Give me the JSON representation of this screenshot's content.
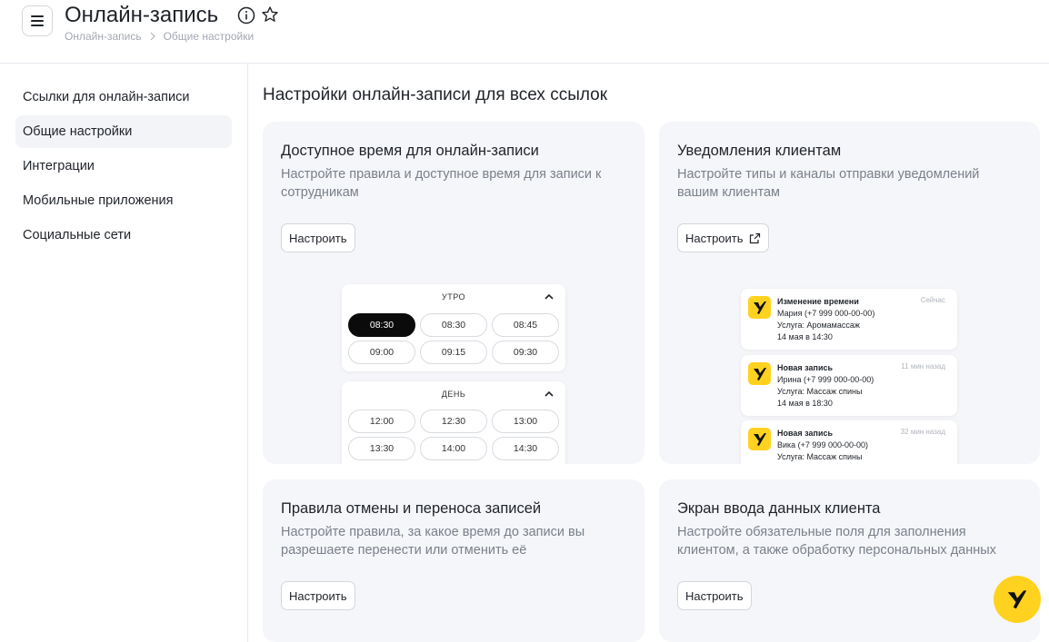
{
  "header": {
    "title": "Онлайн-запись",
    "breadcrumb": [
      "Онлайн-запись",
      "Общие настройки"
    ]
  },
  "sidebar": {
    "items": [
      {
        "label": "Ссылки для онлайн-записи"
      },
      {
        "label": "Общие настройки"
      },
      {
        "label": "Интеграции"
      },
      {
        "label": "Мобильные приложения"
      },
      {
        "label": "Социальные сети"
      }
    ]
  },
  "main": {
    "title": "Настройки онлайн-записи для всех ссылок",
    "cards": [
      {
        "title": "Доступное время для онлайн-записи",
        "desc": "Настройте правила и доступное время для записи к сотрудникам",
        "button": "Настроить"
      },
      {
        "title": "Уведомления клиентам",
        "desc": "Настройте типы и каналы отправки уведомлений вашим клиентам",
        "button": "Настроить"
      },
      {
        "title": "Правила отмены и переноса записей",
        "desc": "Настройте правила, за какое время до записи вы разрешаете перенести или отменить её",
        "button": "Настроить"
      },
      {
        "title": "Экран ввода данных клиента",
        "desc": "Настройте обязательные поля для заполнения клиентом, а также обработку персональных данных",
        "button": "Настроить"
      }
    ],
    "slots": {
      "morning": {
        "label": "УТРО",
        "times": [
          "08:30",
          "08:30",
          "08:45",
          "09:00",
          "09:15",
          "09:30"
        ]
      },
      "day": {
        "label": "ДЕНЬ",
        "times": [
          "12:00",
          "12:30",
          "13:00",
          "13:30",
          "14:00",
          "14:30"
        ]
      }
    },
    "notifications": [
      {
        "title": "Изменение времени",
        "client": "Мария (+7 999 000-00-00)",
        "service": "Услуга: Аромамассаж",
        "date": "14 мая в 14:30",
        "time": "Сейчас"
      },
      {
        "title": "Новая запись",
        "client": "Ирина (+7 999 000-00-00)",
        "service": "Услуга: Массаж спины",
        "date": "14 мая в 18:30",
        "time": "11 мин назад"
      },
      {
        "title": "Новая запись",
        "client": "Вика (+7 999 000-00-00)",
        "service": "Услуга: Массаж спины",
        "date": "",
        "time": "32 мин назад"
      }
    ]
  },
  "colors": {
    "accent": "#ffd21f",
    "card_bg": "#f5f6f9",
    "slot_active": "#0b0b0b"
  }
}
